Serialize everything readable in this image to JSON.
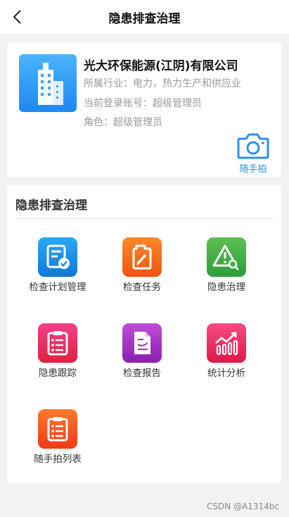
{
  "header": {
    "title": "隐患排查治理",
    "back_icon": "chevron-left-icon"
  },
  "company": {
    "name": "光大环保能源(江阴)有限公司",
    "industry": "所属行业：电力，热力生产和供应业",
    "account": "当前登录账号：超级管理员",
    "role": "角色：超级管理员",
    "logo_icon": "building-icon",
    "camera": {
      "icon": "camera-icon",
      "label": "随手拍"
    }
  },
  "menu": {
    "title": "隐患排查治理",
    "items": [
      {
        "label": "检查计划管理",
        "icon": "checklist-icon",
        "color": "#1a8fe8"
      },
      {
        "label": "检查任务",
        "icon": "task-pencil-icon",
        "color": "#f26a1b"
      },
      {
        "label": "隐患治理",
        "icon": "warning-search-icon",
        "color": "#3fb04a"
      },
      {
        "label": "隐患跟踪",
        "icon": "clipboard-list-icon",
        "color": "#e82c5c"
      },
      {
        "label": "检查报告",
        "icon": "report-document-icon",
        "color": "#a32fc0"
      },
      {
        "label": "统计分析",
        "icon": "bar-chart-icon",
        "color": "#e8255f"
      },
      {
        "label": "随手拍列表",
        "icon": "clipboard-list-icon",
        "color": "#f5501e"
      }
    ]
  },
  "watermark": "CSDN @A1314bc"
}
